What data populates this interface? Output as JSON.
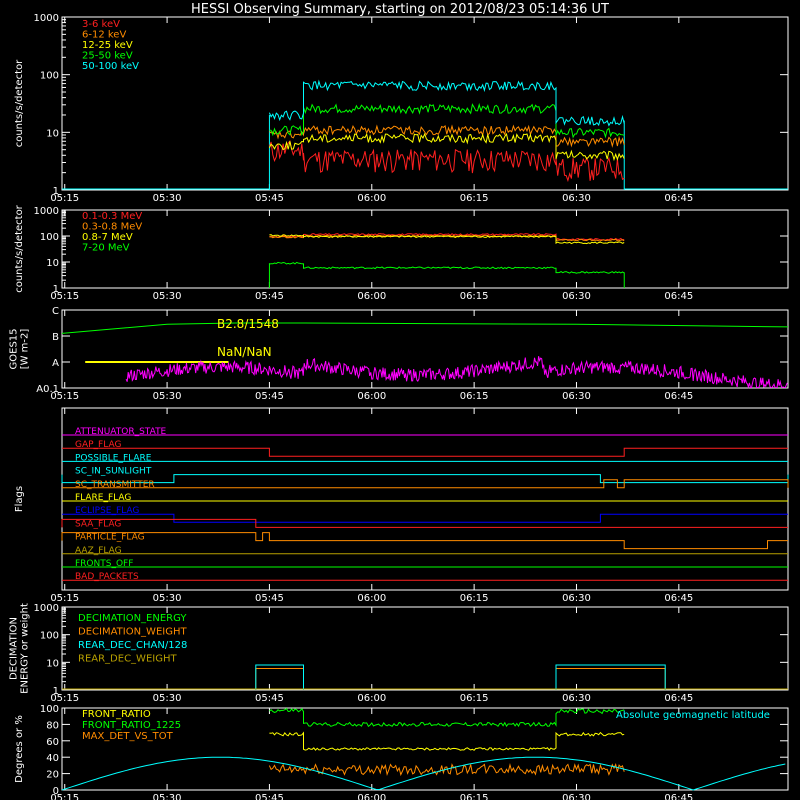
{
  "title": "HESSI Observing Summary, starting on 2012/08/23 05:14:36 UT",
  "colors": {
    "background": "#000000",
    "axes": "#ffffff",
    "red": "#ff2020",
    "orange": "#ff8c00",
    "yellow": "#ffff00",
    "green": "#00ff00",
    "cyan": "#00ffff",
    "magenta": "#ff00ff",
    "blue": "#0000ff",
    "olive": "#b8a000"
  },
  "time_axis": {
    "tick_labels": [
      "05:15",
      "05:30",
      "05:45",
      "06:00",
      "06:15",
      "06:30",
      "06:45"
    ],
    "start_min": 314.6,
    "end_min": 421.0
  },
  "chart_data": [
    {
      "id": "low_energy",
      "type": "line",
      "ylabel": "counts/s/detector",
      "yscale": "log",
      "ylim": [
        1,
        1000
      ],
      "ytick_labels": [
        "1",
        "10",
        "100",
        "1000"
      ],
      "series": [
        {
          "name": "3-6 keV",
          "color": "#ff2020",
          "segments": [
            {
              "x0": 345,
              "x1": 350,
              "y": 5
            },
            {
              "x0": 350,
              "x1": 387,
              "y": 3.5
            },
            {
              "x0": 387,
              "x1": 397,
              "y": 2.5
            }
          ]
        },
        {
          "name": "6-12 keV",
          "color": "#ff8c00",
          "segments": [
            {
              "x0": 345,
              "x1": 350,
              "y": 9
            },
            {
              "x0": 350,
              "x1": 387,
              "y": 11
            },
            {
              "x0": 387,
              "x1": 397,
              "y": 7
            }
          ]
        },
        {
          "name": "12-25 keV",
          "color": "#ffff00",
          "segments": [
            {
              "x0": 345,
              "x1": 350,
              "y": 6
            },
            {
              "x0": 350,
              "x1": 387,
              "y": 8
            },
            {
              "x0": 387,
              "x1": 397,
              "y": 4
            }
          ]
        },
        {
          "name": "25-50 keV",
          "color": "#00ff00",
          "segments": [
            {
              "x0": 345,
              "x1": 350,
              "y": 11
            },
            {
              "x0": 350,
              "x1": 387,
              "y": 26
            },
            {
              "x0": 387,
              "x1": 397,
              "y": 10
            }
          ]
        },
        {
          "name": "50-100 keV",
          "color": "#00ffff",
          "segments": [
            {
              "x0": 345,
              "x1": 350,
              "y": 20
            },
            {
              "x0": 350,
              "x1": 387,
              "y": 65
            },
            {
              "x0": 387,
              "x1": 397,
              "y": 16
            }
          ]
        }
      ]
    },
    {
      "id": "high_energy",
      "type": "line",
      "ylabel": "counts/s/detector",
      "yscale": "log",
      "ylim": [
        1,
        1000
      ],
      "ytick_labels": [
        "1",
        "10",
        "100",
        "1000"
      ],
      "series": [
        {
          "name": "0.1-0.3 MeV",
          "color": "#ff2020",
          "segments": [
            {
              "x0": 345,
              "x1": 350,
              "y": 95
            },
            {
              "x0": 350,
              "x1": 387,
              "y": 115
            },
            {
              "x0": 387,
              "x1": 397,
              "y": 75
            }
          ]
        },
        {
          "name": "0.3-0.8 MeV",
          "color": "#ff8c00",
          "segments": [
            {
              "x0": 345,
              "x1": 350,
              "y": 90
            },
            {
              "x0": 350,
              "x1": 387,
              "y": 100
            },
            {
              "x0": 387,
              "x1": 397,
              "y": 70
            }
          ]
        },
        {
          "name": "0.8-7 MeV",
          "color": "#ffff00",
          "segments": [
            {
              "x0": 345,
              "x1": 350,
              "y": 105
            },
            {
              "x0": 350,
              "x1": 387,
              "y": 95
            },
            {
              "x0": 387,
              "x1": 397,
              "y": 55
            }
          ]
        },
        {
          "name": "7-20 MeV",
          "color": "#00ff00",
          "segments": [
            {
              "x0": 345,
              "x1": 350,
              "y": 9
            },
            {
              "x0": 350,
              "x1": 387,
              "y": 6
            },
            {
              "x0": 387,
              "x1": 397,
              "y": 4
            }
          ]
        }
      ]
    },
    {
      "id": "goes",
      "type": "line",
      "ylabel": "GOES15",
      "yunit": "[W m-2]",
      "ytick_labels": [
        "A0.1",
        "A",
        "B",
        "C"
      ],
      "annotations": [
        "B2.8/1548",
        "NaN/NaN"
      ],
      "series": [
        {
          "name": "GOES long",
          "color": "#00ff00",
          "points": [
            [
              314.6,
              2.1
            ],
            [
              330,
              2.45
            ],
            [
              340,
              2.5
            ],
            [
              350,
              2.5
            ],
            [
              390,
              2.45
            ],
            [
              421,
              2.35
            ]
          ]
        },
        {
          "name": "GOES short",
          "color": "#ff00ff",
          "x_range": [
            324,
            421
          ],
          "level": 0.6
        },
        {
          "name": "GOES short (flat)",
          "color": "#ffff00",
          "points": [
            [
              318,
              1.0
            ],
            [
              339,
              1.0
            ]
          ]
        }
      ]
    },
    {
      "id": "flags",
      "type": "line",
      "ylabel": "Flags",
      "flags": [
        {
          "name": "ATTENUATOR_STATE",
          "color": "#ff00ff",
          "transitions": []
        },
        {
          "name": "GAP_FLAG",
          "color": "#ff2020",
          "transitions": [
            [
              345,
              397,
              "low"
            ]
          ]
        },
        {
          "name": "POSSIBLE_FLARE",
          "color": "#00ffff",
          "transitions": []
        },
        {
          "name": "SC_IN_SUNLIGHT",
          "color": "#00ffff",
          "transitions": [
            [
              314.6,
              331,
              "low"
            ],
            [
              393.5,
              421,
              "low"
            ]
          ]
        },
        {
          "name": "SC_TRANSMITTER",
          "color": "#ff8c00",
          "transitions": [
            [
              394,
              396,
              "high"
            ],
            [
              397,
              421,
              "high"
            ]
          ]
        },
        {
          "name": "FLARE_FLAG",
          "color": "#ffff00",
          "transitions": []
        },
        {
          "name": "ECLIPSE_FLAG",
          "color": "#0000ff",
          "transitions": [
            [
              331,
              393.5,
              "low"
            ]
          ]
        },
        {
          "name": "SAA_FLAG",
          "color": "#ff2020",
          "transitions": [
            [
              314.6,
              343,
              "high"
            ]
          ]
        },
        {
          "name": "PARTICLE_FLAG",
          "color": "#ff8c00",
          "transitions": [
            [
              314.6,
              343,
              "high"
            ],
            [
              344,
              345,
              "high"
            ],
            [
              397,
              418,
              "low"
            ]
          ]
        },
        {
          "name": "AAZ_FLAG",
          "color": "#b8a000",
          "transitions": []
        },
        {
          "name": "FRONTS_OFF",
          "color": "#00ff00",
          "transitions": []
        },
        {
          "name": "BAD_PACKETS",
          "color": "#ff2020",
          "transitions": []
        }
      ]
    },
    {
      "id": "decimation",
      "type": "line",
      "ylabel": "DECIMATION ENERGY or weight",
      "yscale": "log",
      "ylim": [
        1,
        1000
      ],
      "ytick_labels": [
        "1",
        "10",
        "100",
        "1000"
      ],
      "series": [
        {
          "name": "DECIMATION_ENERGY",
          "color": "#00ff00",
          "segments": []
        },
        {
          "name": "DECIMATION_WEIGHT",
          "color": "#ff8c00",
          "segments": [
            {
              "x0": 343,
              "x1": 350,
              "y": 6
            },
            {
              "x0": 387,
              "x1": 403,
              "y": 6
            }
          ]
        },
        {
          "name": "REAR_DEC_CHAN/128",
          "color": "#00ffff",
          "segments": [
            {
              "x0": 343,
              "x1": 350,
              "y": 8
            },
            {
              "x0": 387,
              "x1": 403,
              "y": 8
            }
          ]
        },
        {
          "name": "REAR_DEC_WEIGHT",
          "color": "#b8a000",
          "segments": []
        }
      ]
    },
    {
      "id": "ratios",
      "type": "line",
      "ylabel": "Degrees or %",
      "ylim": [
        0,
        100
      ],
      "ytick_labels": [
        "0",
        "20",
        "40",
        "60",
        "80",
        "100"
      ],
      "series": [
        {
          "name": "FRONT_RATIO",
          "color": "#ffff00",
          "segments": [
            {
              "x0": 345,
              "x1": 350,
              "y": 68
            },
            {
              "x0": 350,
              "x1": 387,
              "y": 50
            },
            {
              "x0": 387,
              "x1": 397,
              "y": 68
            }
          ]
        },
        {
          "name": "FRONT_RATIO_1225",
          "color": "#00ff00",
          "segments": [
            {
              "x0": 345,
              "x1": 350,
              "y": 97
            },
            {
              "x0": 350,
              "x1": 387,
              "y": 80
            },
            {
              "x0": 387,
              "x1": 397,
              "y": 96
            }
          ]
        },
        {
          "name": "MAX_DET_VS_TOT",
          "color": "#ff8c00",
          "segments": [
            {
              "x0": 345,
              "x1": 397,
              "y": 25
            }
          ]
        },
        {
          "name": "Absolute geomagnetic latitude",
          "color": "#00ffff",
          "points": [
            [
              314.6,
              2
            ],
            [
              327,
              24
            ],
            [
              341,
              38
            ],
            [
              347,
              36
            ],
            [
              358,
              18
            ],
            [
              364,
              2
            ],
            [
              372,
              18
            ],
            [
              383,
              30
            ],
            [
              398,
              40
            ],
            [
              410,
              22
            ],
            [
              421,
              2
            ]
          ]
        }
      ]
    }
  ]
}
